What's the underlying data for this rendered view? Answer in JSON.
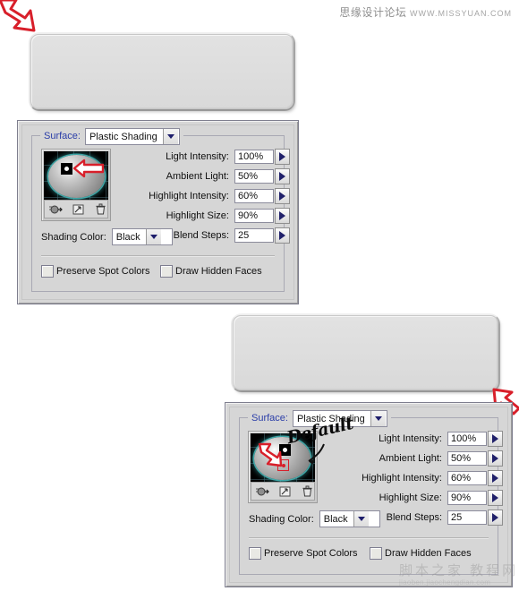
{
  "watermarks": {
    "top_cn": "思缘设计论坛",
    "top_en": "WWW.MISSYUAN.COM",
    "bottom_cn": "脚本之家 教程网",
    "bottom_en": "jiaoben.jiaochengdian.com"
  },
  "annotation": {
    "default_label": "Default"
  },
  "dialog": {
    "group_label": "Surface:",
    "surface_value": "Plastic Shading",
    "shading_color_label": "Shading Color:",
    "shading_color_value": "Black",
    "fields": [
      {
        "label": "Light Intensity:",
        "value": "100%"
      },
      {
        "label": "Ambient Light:",
        "value": "50%"
      },
      {
        "label": "Highlight Intensity:",
        "value": "60%"
      },
      {
        "label": "Highlight Size:",
        "value": "90%"
      },
      {
        "label": "Blend Steps:",
        "value": "25"
      }
    ],
    "checkboxes": [
      {
        "label": "Preserve Spot Colors",
        "checked": false
      },
      {
        "label": "Draw Hidden Faces",
        "checked": false
      }
    ],
    "preview_tools": [
      "new-light-direction-icon",
      "new-light-icon",
      "delete-light-icon"
    ]
  },
  "colors": {
    "panel_bg": "#d6d6d6",
    "legend_text": "#2b3ea8",
    "arrow_red": "#d81f2a",
    "sphere_rim": "#46b9b9",
    "button_face": "#dedede"
  }
}
